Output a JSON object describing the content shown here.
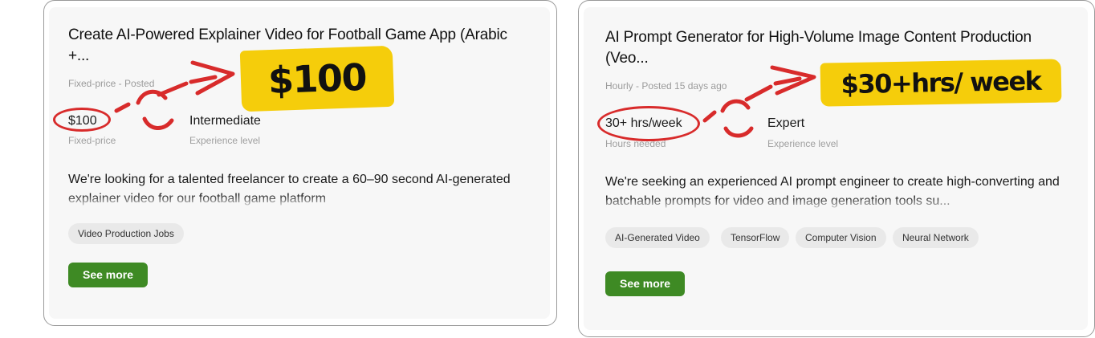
{
  "cards": [
    {
      "title_line1": "Create AI-Powered Explainer Video for Football Game App (Arabic",
      "title_line2": "+...",
      "posted": "Fixed-price - Posted",
      "budget_value": "$100",
      "budget_label": "Fixed-price",
      "level_value": "Intermediate",
      "level_label": "Experience level",
      "description_line1": "We're looking for a talented freelancer to create a 60–90 second AI-generated",
      "description_line2": "explainer video for our football game platform",
      "tags": [
        "Video Production Jobs"
      ],
      "see_more": "See more",
      "callout": "$100"
    },
    {
      "title_line1": "AI Prompt Generator for High-Volume Image Content Production",
      "title_line2": "(Veo...",
      "posted": "Hourly - Posted 15 days ago",
      "budget_value": "30+ hrs/week",
      "budget_label": "Hours needed",
      "level_value": "Expert",
      "level_label": "Experience level",
      "description_line1": "We're seeking an experienced AI prompt engineer to create high-converting and",
      "description_line2": "batchable prompts for video and image generation tools su...",
      "tags": [
        "AI-Generated Video",
        "TensorFlow",
        "Computer Vision",
        "Neural Network"
      ],
      "see_more": "See more",
      "callout": "$30+hrs/ week"
    }
  ],
  "colors": {
    "accent_green": "#3e8a24",
    "annotation_red": "#d82b2b",
    "highlight_yellow": "#f5cd0b"
  }
}
